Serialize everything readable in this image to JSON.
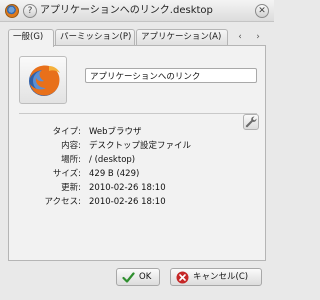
{
  "window": {
    "title": "アプリケーションへのリンク.desktop",
    "icon": "firefox-icon"
  },
  "tabs": [
    {
      "label": "一般(G)",
      "active": true
    },
    {
      "label": "パーミッション(P)",
      "active": false
    },
    {
      "label": "アプリケーション(A)",
      "active": false
    }
  ],
  "general": {
    "name_value": "アプリケーションへのリンク",
    "properties": [
      {
        "label": "タイプ:",
        "value": "Webブラウザ"
      },
      {
        "label": "内容:",
        "value": "デスクトップ設定ファイル"
      },
      {
        "label": "場所:",
        "value": "/ (desktop)"
      },
      {
        "label": "サイズ:",
        "value": "429 B (429)"
      },
      {
        "label": "更新:",
        "value": "2010-02-26 18:10"
      },
      {
        "label": "アクセス:",
        "value": "2010-02-26 18:10"
      }
    ]
  },
  "buttons": {
    "ok": "OK",
    "cancel": "キャンセル(C)"
  },
  "colors": {
    "accent_ok": "#2f8f2f",
    "accent_cancel": "#c62828"
  }
}
